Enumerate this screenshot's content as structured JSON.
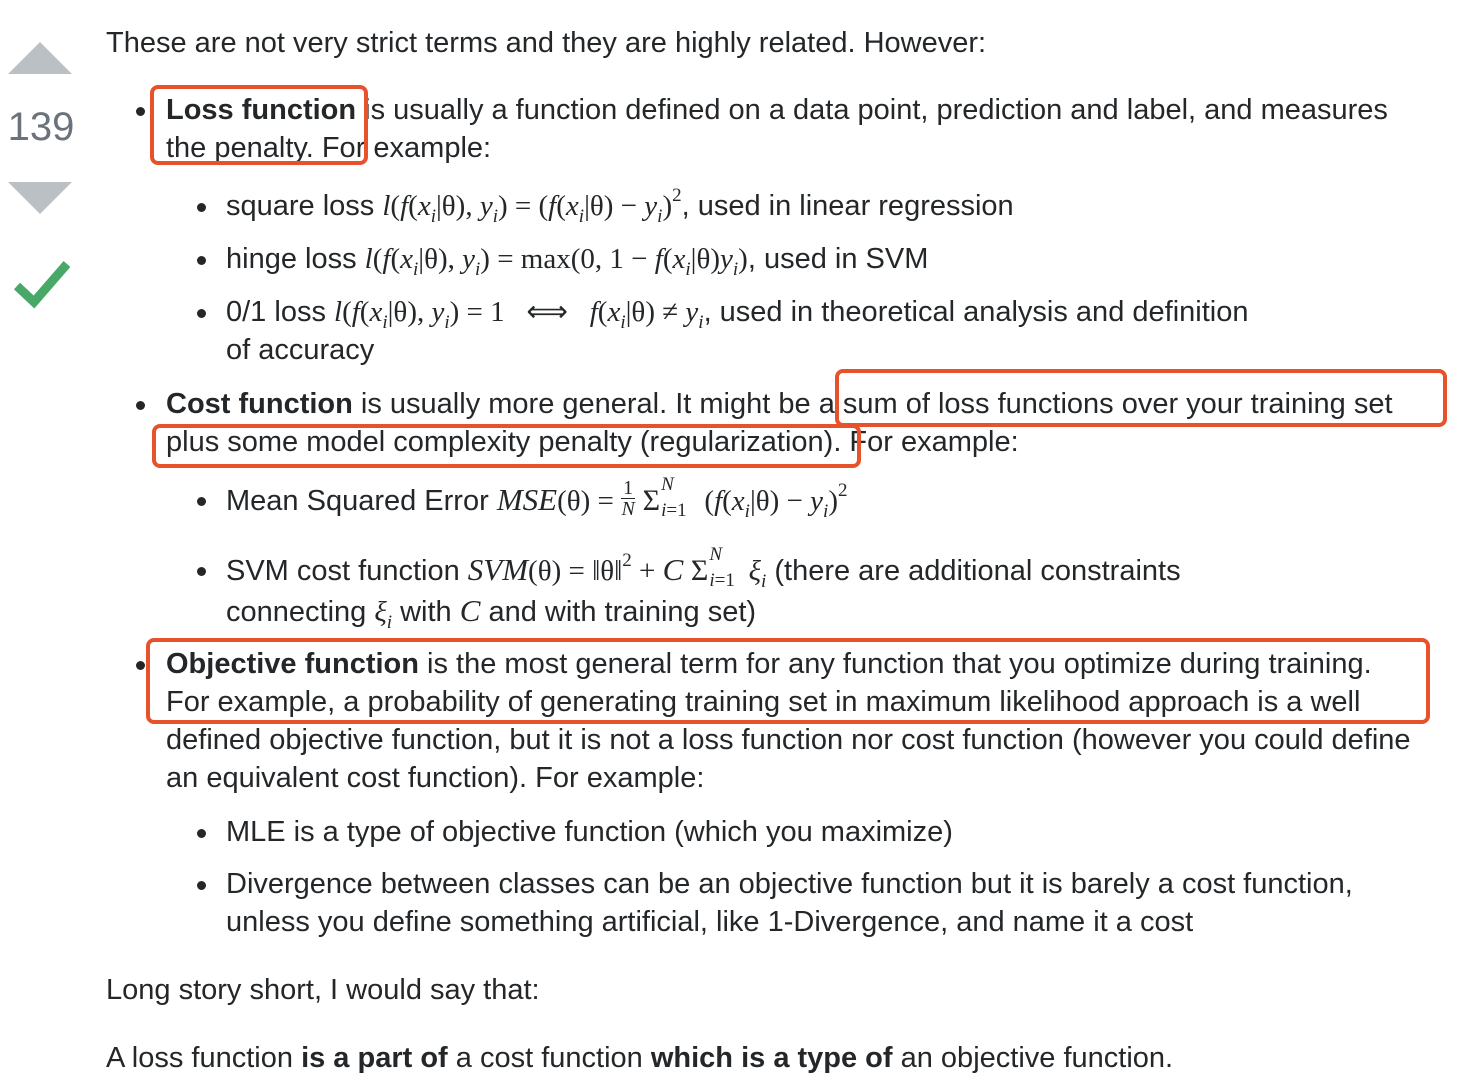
{
  "votes": {
    "count": "139"
  },
  "answer": {
    "intro": "These are not very strict terms and they are highly related. However:",
    "loss": {
      "term": "Loss function",
      "line1": " is usually a function defined on a data point, prediction and label, and measures",
      "line2": "the penalty. For example:",
      "items": [
        {
          "label": "square loss ",
          "formula": "l(f(x|θ), y) = (f(x|θ) − y)²",
          "suffix": ", used in linear regression"
        },
        {
          "label": "hinge loss ",
          "formula": "l(f(x|θ), y) = max(0, 1 − f(x|θ)y)",
          "suffix": ", used in SVM"
        },
        {
          "label": "0/1 loss ",
          "formula": "l(f(x|θ), y) = 1 ⟺ f(x|θ) ≠ y",
          "suffix": ", used in theoretical analysis and definition",
          "line2": "of accuracy"
        }
      ]
    },
    "cost": {
      "term": "Cost function",
      "line1a": " is usually more general. It might be ",
      "line1b": "a sum of loss functions over your training set",
      "line2a": "plus some model complexity penalty (regularization)",
      "line2b": ". For example:",
      "items": [
        {
          "label": "Mean Squared Error ",
          "formula": "MSE(θ) = 1/N Σ (f(x|θ) − y)²"
        },
        {
          "label": "SVM cost function ",
          "formula": "SVM(θ) = ‖θ‖² + C Σ ξ",
          "suffix": " (there are additional constraints",
          "line2a": "connecting ",
          "line2b": " with ",
          "line2c": " and with training set)"
        }
      ]
    },
    "objective": {
      "term": "Objective function",
      "line1": " is the most general term for any function that you optimize during training.",
      "line2": "For example, a probability of generating training set in maximum likelihood approach is a well",
      "line3": "defined objective function, but it is not a loss function nor cost function (however you could define",
      "line4": "an equivalent cost function). For example:",
      "items": [
        {
          "text": "MLE is a type of objective function (which you maximize)"
        },
        {
          "text": "Divergence between classes can be an objective function but it is barely a cost function,",
          "line2": "unless you define something artificial, like 1-Divergence, and name it a cost"
        }
      ]
    },
    "summary_intro": "Long story short, I would say that:",
    "summary": {
      "a": "A loss function ",
      "b": "is a part of",
      "c": " a cost function ",
      "d": "which is a type of",
      "e": " an objective function."
    }
  },
  "colors": {
    "highlight": "#e8522b",
    "accepted": "#48a868",
    "arrow": "#bbc0c4"
  }
}
